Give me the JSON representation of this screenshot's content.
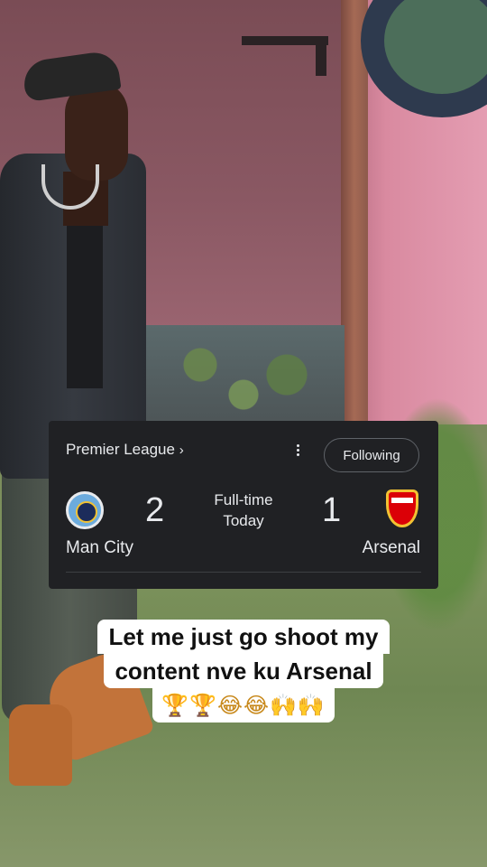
{
  "scorecard": {
    "league": "Premier League",
    "league_chevron": "›",
    "more_icon": "more-vert-icon",
    "follow_label": "Following",
    "home": {
      "name": "Man City",
      "score": "2",
      "crest": "manchester-city-crest"
    },
    "away": {
      "name": "Arsenal",
      "score": "1",
      "crest": "arsenal-crest"
    },
    "status": "Full-time",
    "date": "Today",
    "colors": {
      "card_bg": "#202124",
      "text": "#e8eaed",
      "city_blue": "#6cabdd",
      "arsenal_red": "#db0007"
    }
  },
  "caption": {
    "line1": "Let me just go shoot my",
    "line2": "content nve ku Arsenal",
    "emojis": "🏆🏆😂😂🙌🙌"
  }
}
